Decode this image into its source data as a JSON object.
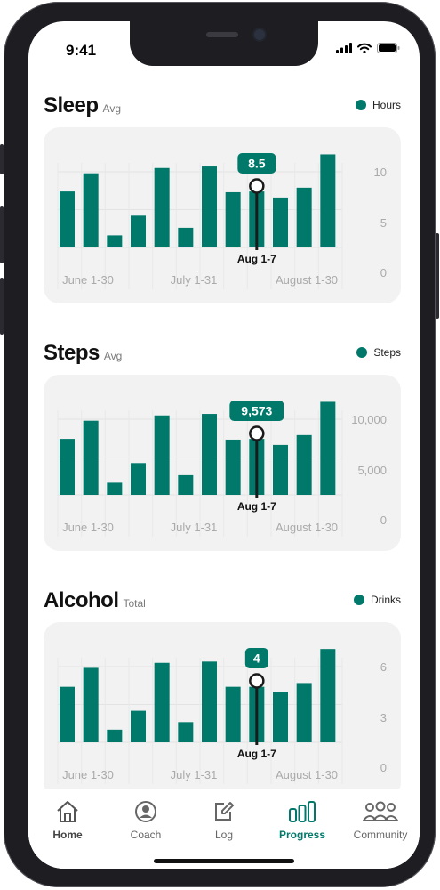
{
  "status": {
    "time": "9:41"
  },
  "colors": {
    "accent": "#00796b",
    "card": "#f2f2f2"
  },
  "sections": [
    {
      "key": "sleep",
      "title": "Sleep",
      "subtitle": "Avg",
      "legend": "Hours",
      "chart_data": {
        "type": "bar",
        "series": [
          {
            "name": "Hours",
            "values": [
              7.4,
              9.8,
              1.6,
              4.2,
              10.5,
              2.6,
              10.7,
              7.3,
              7.4,
              6.6,
              7.9,
              12.3
            ]
          }
        ],
        "highlight_index": 8,
        "highlight_value": "8.5",
        "highlight_label": "Aug 1-7",
        "x_tick_labels": [
          "June 1-30",
          "July 1-31",
          "August 1-30"
        ],
        "y_tick_labels": [
          "10",
          "5",
          "0"
        ],
        "ylim": [
          0,
          10
        ],
        "grid": true
      }
    },
    {
      "key": "steps",
      "title": "Steps",
      "subtitle": "Avg",
      "legend": "Steps",
      "chart_data": {
        "type": "bar",
        "series": [
          {
            "name": "Steps",
            "values": [
              7400,
              9800,
              1600,
              4200,
              10500,
              2600,
              10700,
              7300,
              7400,
              6600,
              7900,
              12300
            ]
          }
        ],
        "highlight_index": 8,
        "highlight_value": "9,573",
        "highlight_label": "Aug 1-7",
        "x_tick_labels": [
          "June 1-30",
          "July 1-31",
          "August 1-30"
        ],
        "y_tick_labels": [
          "10,000",
          "5,000",
          "0"
        ],
        "ylim": [
          0,
          10000
        ],
        "grid": true
      }
    },
    {
      "key": "alcohol",
      "title": "Alcohol",
      "subtitle": "Total",
      "legend": "Drinks",
      "chart_data": {
        "type": "bar",
        "series": [
          {
            "name": "Drinks",
            "values": [
              4.4,
              5.9,
              1.0,
              2.5,
              6.3,
              1.6,
              6.4,
              4.4,
              4.4,
              4.0,
              4.7,
              7.4
            ]
          }
        ],
        "highlight_index": 8,
        "highlight_value": "4",
        "highlight_label": "Aug 1-7",
        "x_tick_labels": [
          "June 1-30",
          "July 1-31",
          "August 1-30"
        ],
        "y_tick_labels": [
          "6",
          "3",
          "0"
        ],
        "ylim": [
          0,
          6
        ],
        "grid": true
      }
    }
  ],
  "tabs": [
    {
      "label": "Home",
      "icon": "home-icon"
    },
    {
      "label": "Coach",
      "icon": "person-icon"
    },
    {
      "label": "Log",
      "icon": "edit-icon"
    },
    {
      "label": "Progress",
      "icon": "bar-chart-icon"
    },
    {
      "label": "Community",
      "icon": "group-icon"
    }
  ]
}
